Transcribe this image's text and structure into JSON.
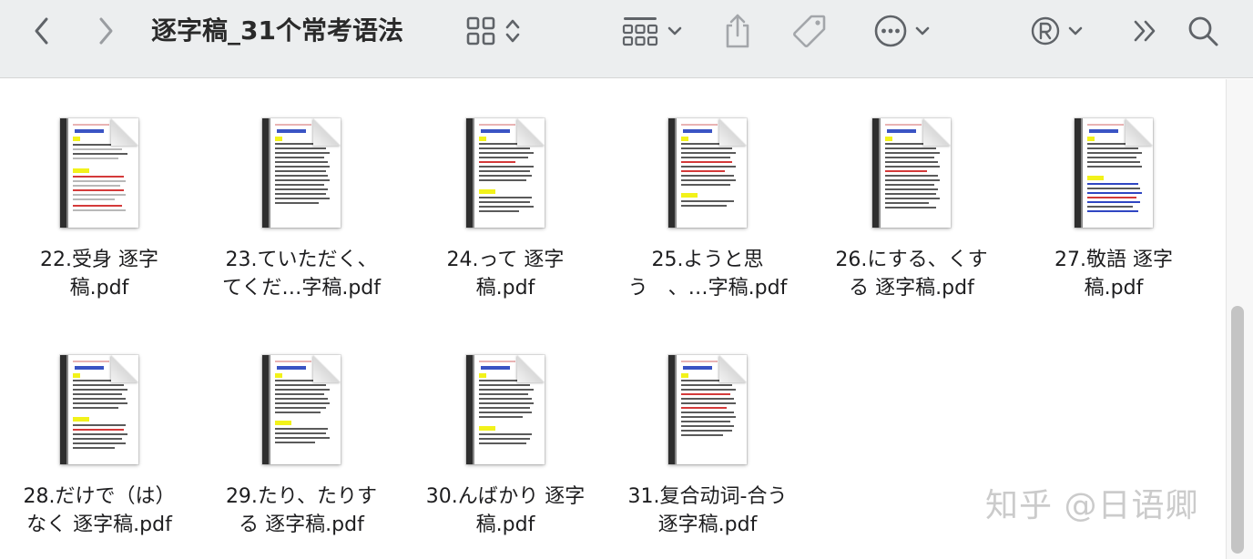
{
  "toolbar": {
    "title": "逐字稿_31个常考语法",
    "icons": [
      "back-icon",
      "forward-icon",
      "grid-view-icon",
      "view-updown-icon",
      "group-icon",
      "chevron-down-icon",
      "share-icon",
      "tag-icon",
      "more-icon",
      "chevron-down-icon",
      "registered-icon",
      "chevron-down-icon",
      "overflow-icon",
      "search-icon"
    ]
  },
  "files": [
    {
      "line1": "22.受身 逐字",
      "line2": "稿.pdf"
    },
    {
      "line1": "23.ていただく、",
      "line2": "てくだ…字稿.pdf"
    },
    {
      "line1": "24.って 逐字",
      "line2": "稿.pdf"
    },
    {
      "line1": "25.ようと思",
      "line2": "う　、…字稿.pdf"
    },
    {
      "line1": "26.にする、くす",
      "line2": "る 逐字稿.pdf"
    },
    {
      "line1": "27.敬語 逐字",
      "line2": "稿.pdf"
    },
    {
      "line1": "28.だけで（は）",
      "line2": "なく 逐字稿.pdf"
    },
    {
      "line1": "29.たり、たりす",
      "line2": "る 逐字稿.pdf"
    },
    {
      "line1": "30.んばかり 逐字",
      "line2": "稿.pdf"
    },
    {
      "line1": "31.复合动词-合う",
      "line2": "逐字稿.pdf"
    }
  ],
  "watermark": "知乎 @日语卿",
  "colors": {
    "toolbar_bg": "#eceeef",
    "icon": "#5f6368",
    "title": "#2a2a2a",
    "highlight": "#f2f21a",
    "doc_blue": "#2f46c2",
    "doc_red": "#d43a3a"
  }
}
